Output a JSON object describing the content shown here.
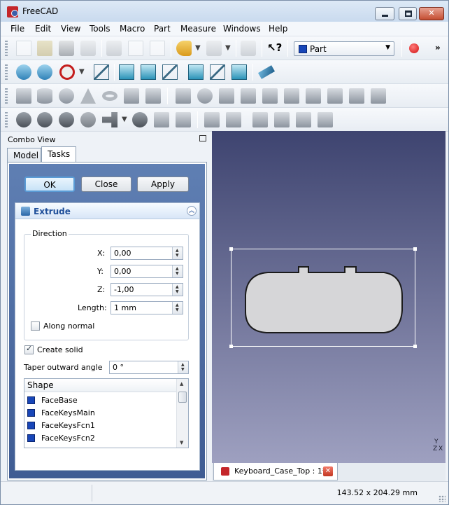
{
  "window": {
    "title": "FreeCAD",
    "controls": {
      "minimize": "minimize",
      "maximize": "maximize",
      "close": "✕"
    }
  },
  "menu": [
    "File",
    "Edit",
    "View",
    "Tools",
    "Macro",
    "Part",
    "Measure",
    "Windows",
    "Help"
  ],
  "toolbar": {
    "workbench": "Part",
    "overflow": "»"
  },
  "combo_view": {
    "title": "Combo View",
    "tabs": [
      "Model",
      "Tasks"
    ],
    "active_tab": "Tasks",
    "buttons": {
      "ok": "OK",
      "close": "Close",
      "apply": "Apply"
    },
    "taskbox": {
      "title": "Extrude",
      "direction": {
        "legend": "Direction",
        "x_label": "X:",
        "x_value": "0,00",
        "y_label": "Y:",
        "y_value": "0,00",
        "z_label": "Z:",
        "z_value": "-1,00",
        "length_label": "Length:",
        "length_value": "1 mm",
        "along_normal": "Along normal",
        "along_normal_checked": false
      },
      "create_solid": "Create solid",
      "create_solid_checked": true,
      "taper_label": "Taper outward angle",
      "taper_value": "0 °",
      "shape_list": {
        "header": "Shape",
        "items": [
          "FaceBase",
          "FaceKeysMain",
          "FaceKeysFcn1",
          "FaceKeysFcn2"
        ]
      }
    }
  },
  "viewer": {
    "axis": {
      "y": "Y",
      "z": "Z",
      "x": "X"
    },
    "background_top": "#3e4470",
    "background_bottom": "#9ea0c0"
  },
  "document_tab": {
    "label": "Keyboard_Case_Top : 1*",
    "close": "✕"
  },
  "status": {
    "dimensions": "143.52 x 204.29 mm"
  }
}
